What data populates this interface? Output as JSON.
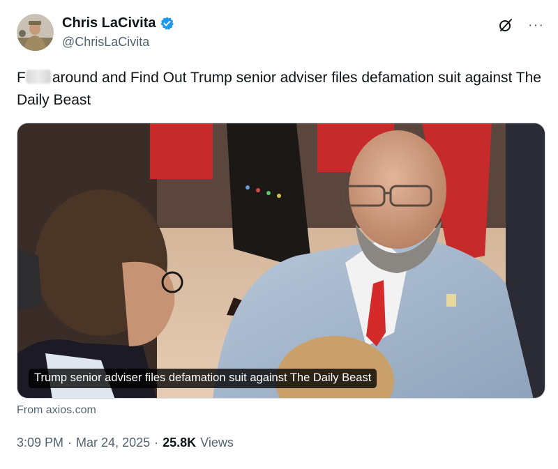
{
  "author": {
    "display_name": "Chris LaCivita",
    "handle": "@ChrisLaCivita",
    "verified_icon": "verified-badge-icon",
    "badge_color": "#1d9bf0"
  },
  "tweet": {
    "text_prefix": "F",
    "text_censored_icon": "blurred-text",
    "text_rest": "around and Find Out Trump senior adviser files defamation suit against The Daily Beast"
  },
  "media": {
    "caption": "Trump senior adviser files defamation suit against The Daily Beast",
    "source": "From axios.com"
  },
  "meta": {
    "time": "3:09 PM",
    "date": "Mar 24, 2025",
    "views_count": "25.8K",
    "views_label": "Views",
    "separator": "·"
  },
  "icons": {
    "grok": "grok-icon",
    "more": "more-icon",
    "more_glyph": "···"
  }
}
